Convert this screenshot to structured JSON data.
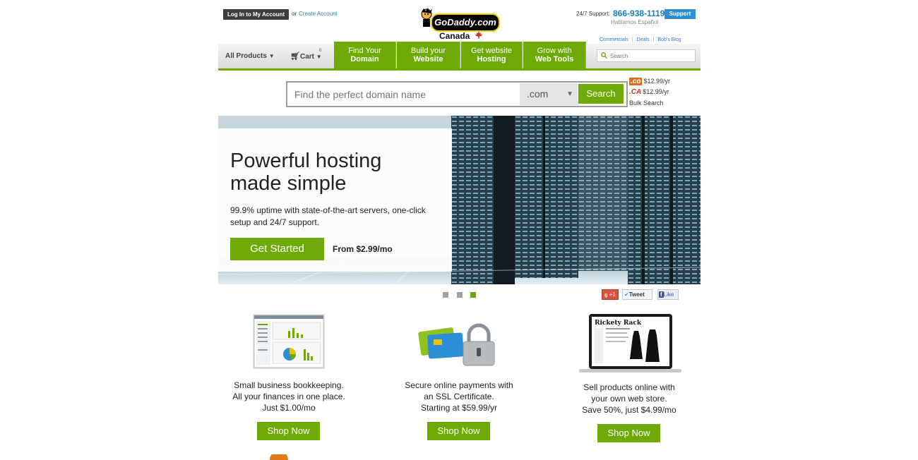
{
  "header": {
    "login_label": "Log In to My Account",
    "or_text": "or",
    "create_account_label": "Create Account",
    "logo_text": "GoDaddy.com",
    "region": "Canada",
    "support_label": "24/7 Support:",
    "support_phone": "866-938-1119",
    "support_button": "Support",
    "hablamos": "Hablamos Español",
    "links": [
      "Commercials",
      "Deals",
      "Bob's Blog"
    ]
  },
  "nav": {
    "all_products": "All Products",
    "cart": "Cart",
    "cart_count": "0",
    "items": [
      {
        "l1": "Find Your",
        "l2": "Domain"
      },
      {
        "l1": "Build your",
        "l2": "Website"
      },
      {
        "l1": "Get website",
        "l2": "Hosting"
      },
      {
        "l1": "Grow with",
        "l2": "Web Tools"
      }
    ],
    "search_placeholder": "Search"
  },
  "domain_search": {
    "placeholder": "Find the perfect domain name",
    "tld_selected": ".com",
    "button": "Search",
    "tld_prices": [
      {
        "tld": ".co",
        "price": "$12.99/yr",
        "color": "#e06b1a"
      },
      {
        "tld": ".CA",
        "price": "$12.99/yr",
        "color": "#c0392b"
      }
    ],
    "bulk_search": "Bulk Search"
  },
  "hero": {
    "title": "Powerful hosting made simple",
    "subtitle": "99.9% uptime with state-of-the-art servers, one-click setup and 24/7 support.",
    "cta": "Get Started",
    "price": "From $2.99/mo"
  },
  "carousel": {
    "active_index": 2,
    "count": 3
  },
  "social": {
    "gplus": "+1",
    "tweet": "Tweet",
    "like": "Like"
  },
  "products": [
    {
      "l1": "Small business bookkeeping.",
      "l2": "All your finances in one place.",
      "l3": "Just $1.00/mo",
      "button": "Shop Now"
    },
    {
      "l1": "Secure online payments with",
      "l2": "an SSL Certificate.",
      "l3": "Starting at $59.99/yr",
      "button": "Shop Now"
    },
    {
      "l1": "Sell products online with",
      "l2": "your own web store.",
      "l3": "Save 50%, just $4.99/mo",
      "button": "Shop Now",
      "store_name": "Rickety Rack"
    }
  ],
  "colors": {
    "green": "#6fa905",
    "blue": "#2d8ed6",
    "dark": "#3d3d3d"
  }
}
